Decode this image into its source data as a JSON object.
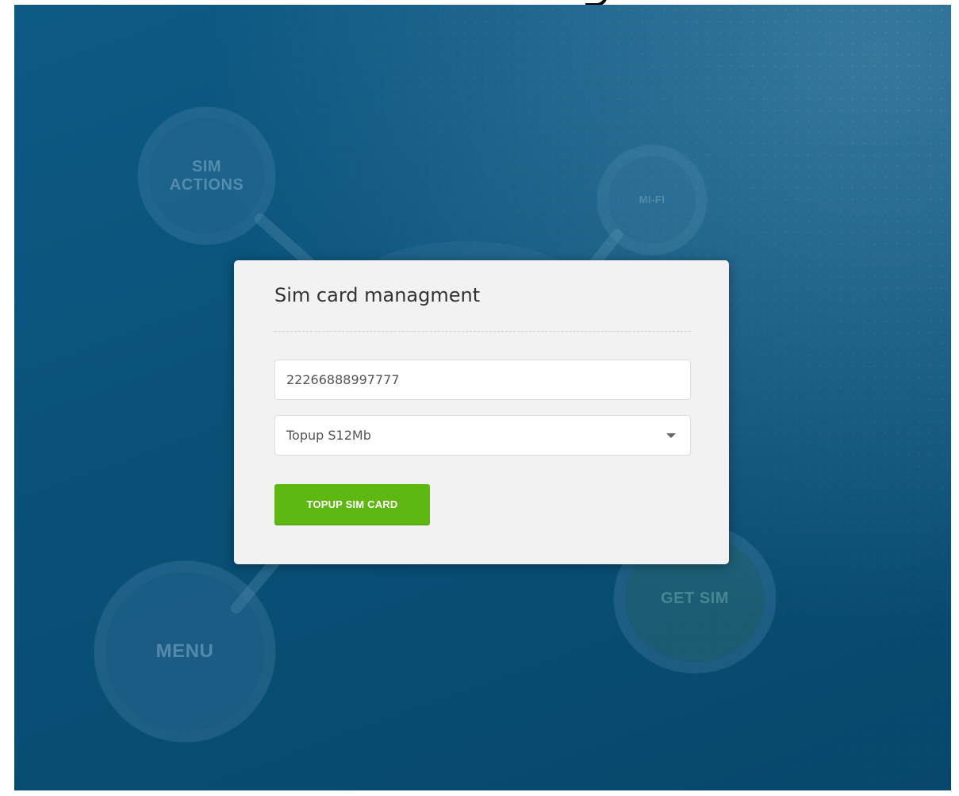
{
  "background": {
    "bubbles": {
      "sim_actions": "SIM\nACTIONS",
      "mi_fi": "MI-FI",
      "menu": "MENU",
      "get_sim": "GET SIM"
    }
  },
  "card": {
    "title": "Sim card managment",
    "sim_number": "22266888997777",
    "topup_option": "Topup S12Mb",
    "submit_label": "TOPUP SIM CARD"
  },
  "colors": {
    "background": "#0a5178",
    "card": "#f2f2f2",
    "button": "#5fb712"
  }
}
